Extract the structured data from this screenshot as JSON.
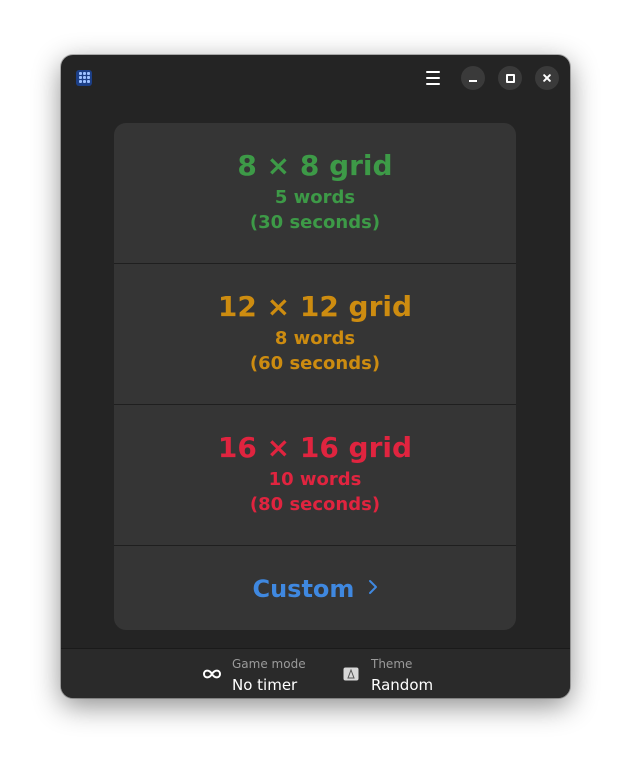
{
  "header": {
    "app_icon": "word-grid-app-icon",
    "menu_icon": "hamburger-menu-icon",
    "window_controls": [
      "minimize-icon",
      "maximize-icon",
      "close-icon"
    ]
  },
  "difficulties": [
    {
      "title": "8 × 8 grid",
      "words": "5 words",
      "time": "(30 seconds)",
      "color": "#3d9a47"
    },
    {
      "title": "12 × 12 grid",
      "words": "8 words",
      "time": "(60 seconds)",
      "color": "#cd8c10"
    },
    {
      "title": "16 × 16 grid",
      "words": "10 words",
      "time": "(80 seconds)",
      "color": "#e0243f"
    }
  ],
  "custom": {
    "label": "Custom",
    "color": "#3f88e0",
    "icon": "chevron-right-icon"
  },
  "bottom": {
    "game_mode": {
      "caption": "Game mode",
      "value": "No timer",
      "icon": "infinity-icon"
    },
    "theme": {
      "caption": "Theme",
      "value": "Random",
      "icon": "theme-icon"
    }
  },
  "colors": {
    "window_bg": "#242424",
    "card_bg": "#353535",
    "bottombar_bg": "#2a2a2a"
  }
}
